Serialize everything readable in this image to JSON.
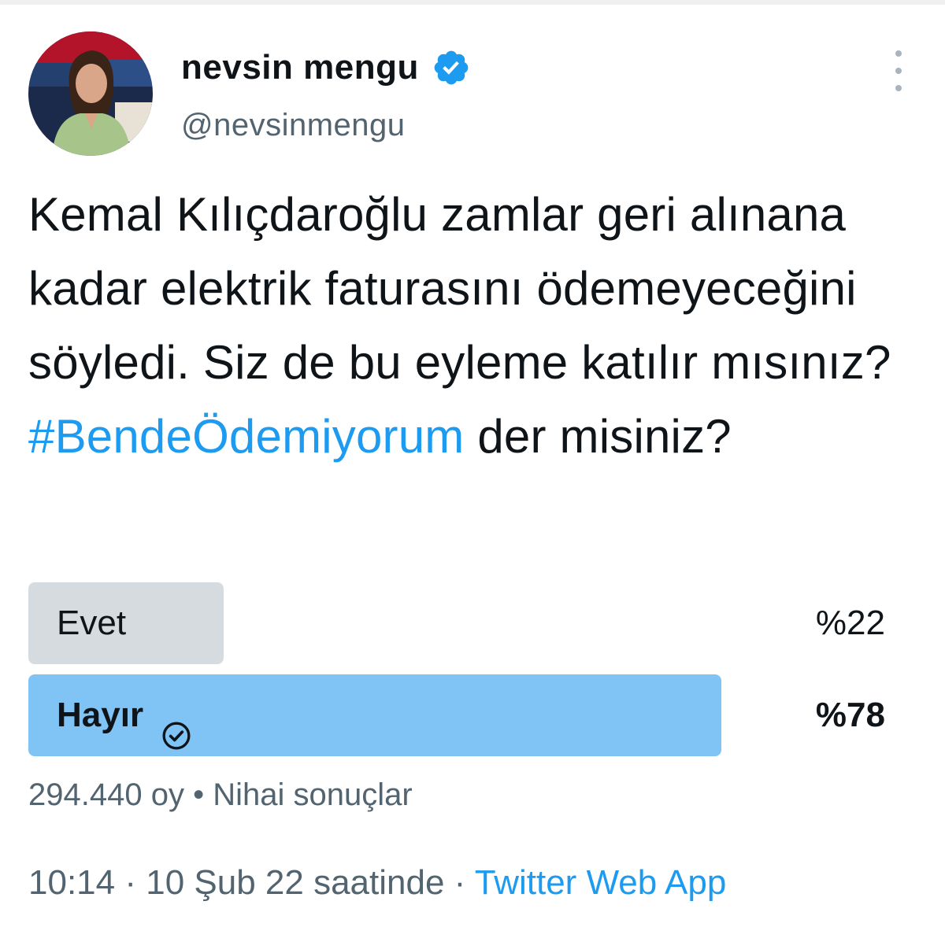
{
  "author": {
    "display_name": "nevsin mengu",
    "handle": "@nevsinmengu",
    "avatar_icon": "user-avatar",
    "verified_icon": "verified-badge-icon"
  },
  "more_icon": "more-options-icon",
  "tweet": {
    "text": "Kemal Kılıçdaroğlu zamlar geri alınana kadar elektrik faturasını ödemeyeceğini söyledi. Siz de bu eyleme katılır mısınız?",
    "hashtag": "#BendeÖdemiyorum",
    "text_suffix": "der misiniz?"
  },
  "poll": {
    "options": [
      {
        "label": "Evet",
        "percent_label": "%22",
        "share": 0.22,
        "selected": false
      },
      {
        "label": "Hayır",
        "percent_label": "%78",
        "share": 0.78,
        "selected": true
      }
    ],
    "votes": "294.440 oy",
    "separator": "•",
    "status": "Nihai sonuçlar"
  },
  "meta": {
    "time": "10:14",
    "sep1": "·",
    "date": "10 Şub 22 saatinde",
    "sep2": "·",
    "source": "Twitter Web App"
  },
  "colors": {
    "link": "#1d9bf0",
    "verified": "#1d9bf0",
    "winning_bar": "#80c4f5",
    "losing_bar": "#d6dbe0",
    "secondary_text": "#536471"
  }
}
